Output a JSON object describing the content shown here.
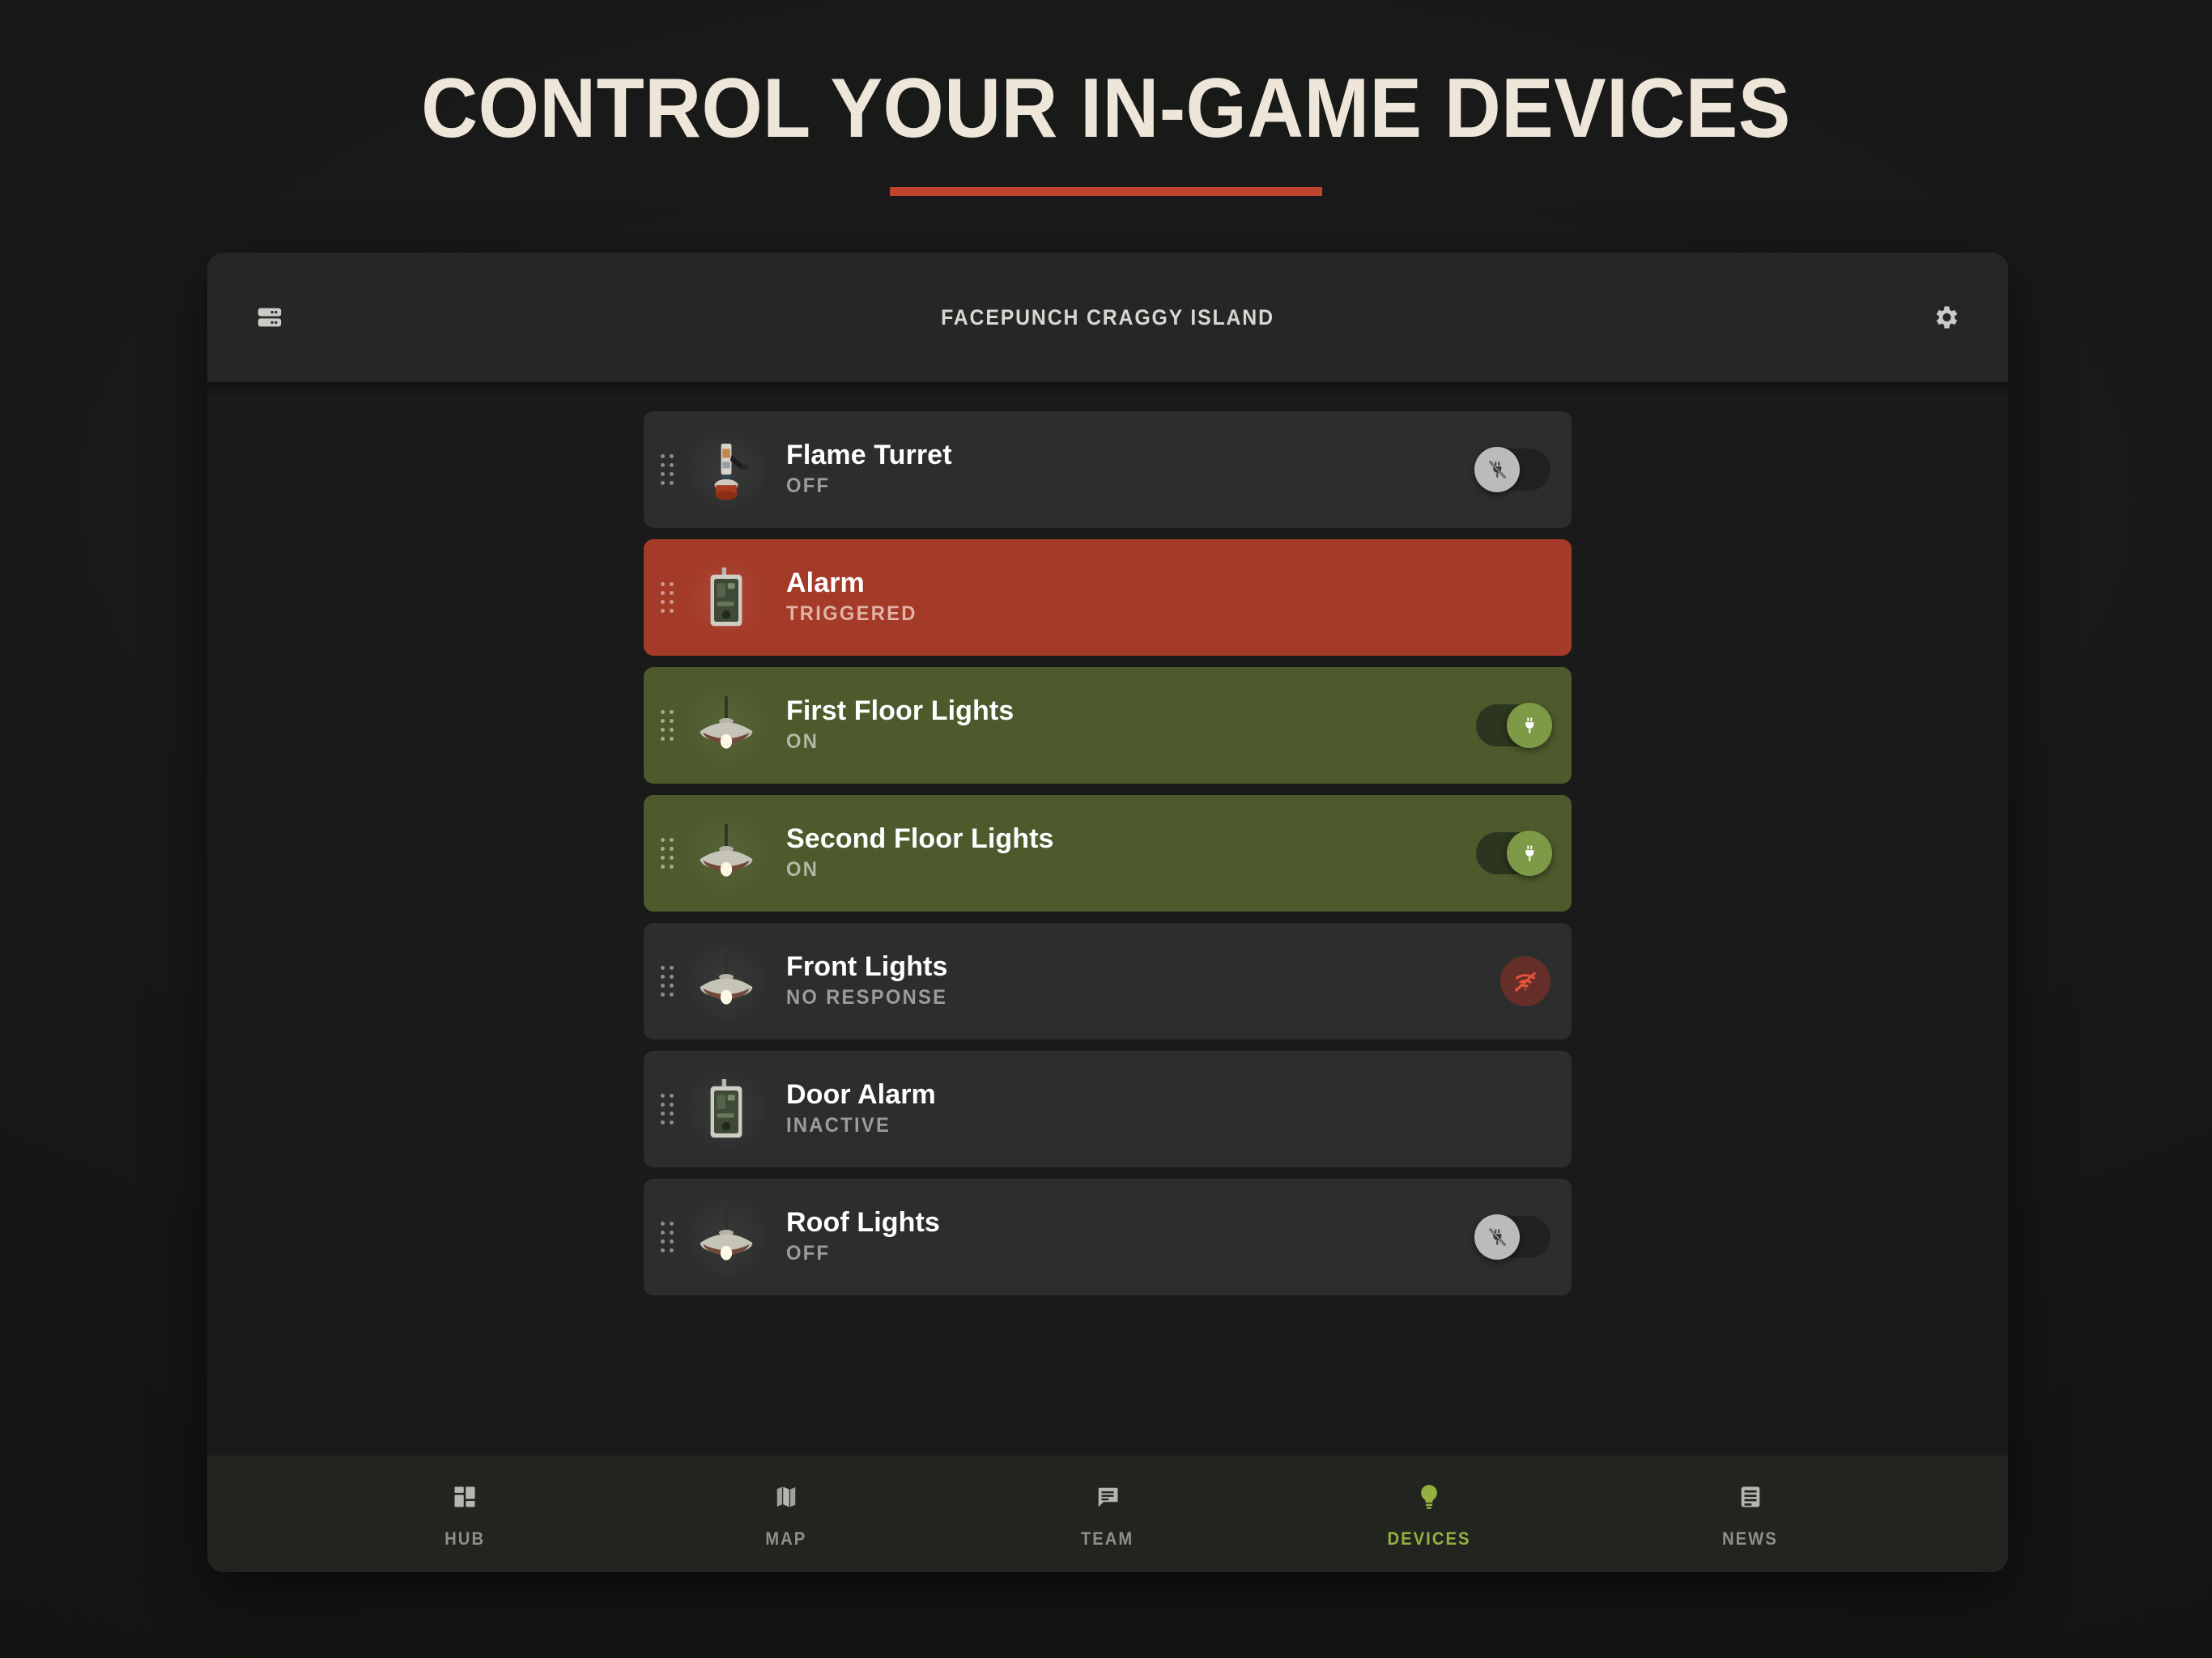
{
  "hero": {
    "title": "CONTROL YOUR IN-GAME DEVICES",
    "accent_color": "#c0452e"
  },
  "panel": {
    "header": {
      "server_name": "FACEPUNCH CRAGGY ISLAND",
      "left_icon": "server-rack-icon",
      "right_icon": "gear-icon"
    },
    "devices": [
      {
        "name": "Flame Turret",
        "status": "OFF",
        "state": "off",
        "thumbnail": "flame-turret-thumbnail",
        "control": "toggle-off",
        "control_icon": "plug-off-icon"
      },
      {
        "name": "Alarm",
        "status": "TRIGGERED",
        "state": "triggered",
        "thumbnail": "alarm-module-thumbnail",
        "control": "none",
        "control_icon": ""
      },
      {
        "name": "First Floor Lights",
        "status": "ON",
        "state": "on",
        "thumbnail": "ceiling-lamp-thumbnail",
        "control": "toggle-on",
        "control_icon": "plug-icon"
      },
      {
        "name": "Second Floor Lights",
        "status": "ON",
        "state": "on",
        "thumbnail": "ceiling-lamp-thumbnail",
        "control": "toggle-on",
        "control_icon": "plug-icon"
      },
      {
        "name": "Front Lights",
        "status": "NO RESPONSE",
        "state": "offline",
        "thumbnail": "ceiling-lamp-thumbnail",
        "control": "offline-badge",
        "control_icon": "wifi-off-icon"
      },
      {
        "name": "Door Alarm",
        "status": "INACTIVE",
        "state": "inactive",
        "thumbnail": "alarm-module-thumbnail",
        "control": "none",
        "control_icon": ""
      },
      {
        "name": "Roof Lights",
        "status": "OFF",
        "state": "off",
        "thumbnail": "ceiling-lamp-thumbnail",
        "control": "toggle-off",
        "control_icon": "plug-off-icon"
      }
    ],
    "colors": {
      "row_default": "#2b2e2c",
      "row_triggered": "#a43a28",
      "row_on": "#4c5a2c",
      "active_nav": "#93b13f"
    }
  },
  "bottom_nav": {
    "items": [
      {
        "label": "HUB",
        "icon": "dashboard-grid-icon",
        "active": false
      },
      {
        "label": "MAP",
        "icon": "map-icon",
        "active": false
      },
      {
        "label": "TEAM",
        "icon": "chat-bubble-icon",
        "active": false
      },
      {
        "label": "DEVICES",
        "icon": "lightbulb-icon",
        "active": true
      },
      {
        "label": "NEWS",
        "icon": "news-list-icon",
        "active": false
      }
    ]
  }
}
